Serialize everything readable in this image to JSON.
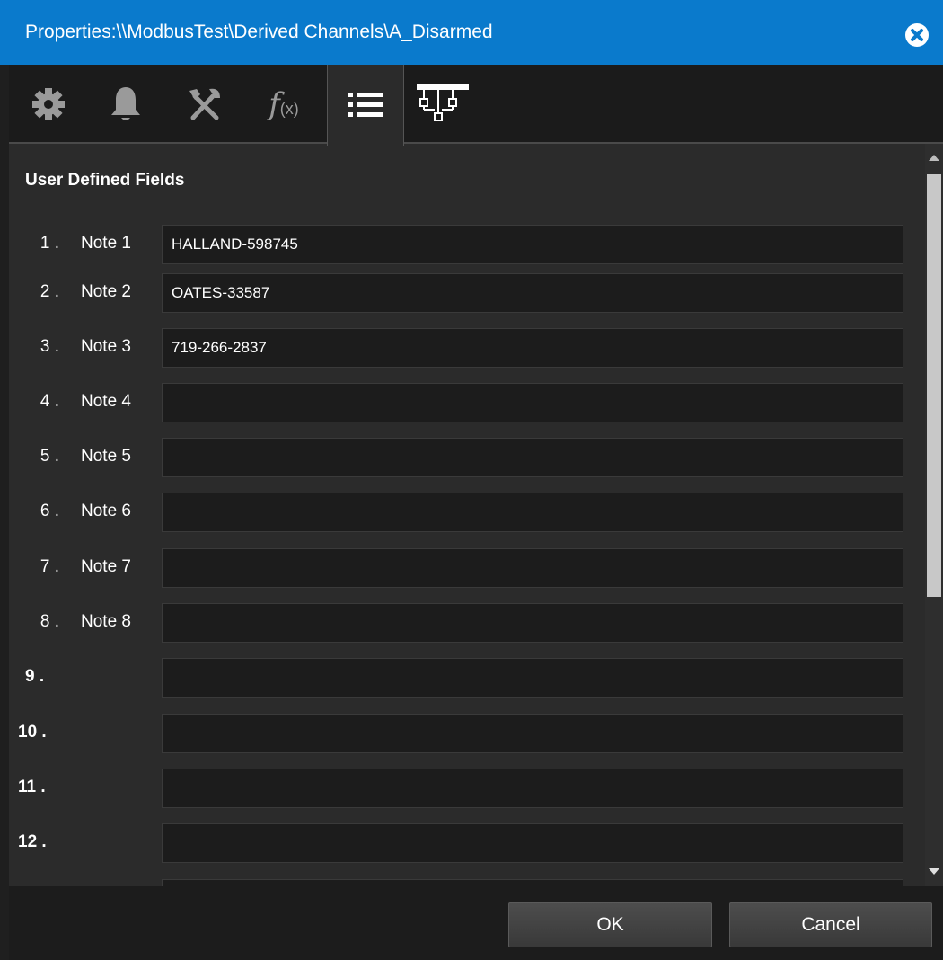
{
  "window": {
    "title": "Properties:\\\\ModbusTest\\Derived Channels\\A_Disarmed"
  },
  "toolbar": {
    "tools": [
      {
        "icon": "gear-icon"
      },
      {
        "icon": "bell-icon"
      },
      {
        "icon": "tools-icon"
      },
      {
        "icon": "function-icon",
        "label_f": "f",
        "label_x": "(x)"
      },
      {
        "icon": "list-icon",
        "active": true
      },
      {
        "icon": "network-icon"
      }
    ]
  },
  "section": {
    "title": "User Defined Fields"
  },
  "fields": [
    {
      "num": "1 .",
      "label": "Note 1",
      "value": "HALLAND-598745"
    },
    {
      "num": "2 .",
      "label": "Note 2",
      "value": "OATES-33587"
    },
    {
      "num": "3 .",
      "label": "Note 3",
      "value": "719-266-2837"
    },
    {
      "num": "4 .",
      "label": "Note 4",
      "value": ""
    },
    {
      "num": "5 .",
      "label": "Note 5",
      "value": ""
    },
    {
      "num": "6 .",
      "label": "Note 6",
      "value": ""
    },
    {
      "num": "7 .",
      "label": "Note 7",
      "value": ""
    },
    {
      "num": "8 .",
      "label": "Note 8",
      "value": ""
    },
    {
      "num": "9 .",
      "label": "",
      "value": ""
    },
    {
      "num": "10 .",
      "label": "",
      "value": ""
    },
    {
      "num": "11 .",
      "label": "",
      "value": ""
    },
    {
      "num": "12 .",
      "label": "",
      "value": ""
    }
  ],
  "footer": {
    "ok_label": "OK",
    "cancel_label": "Cancel"
  },
  "colors": {
    "titlebar": "#0a7acc",
    "background": "#2b2b2b",
    "input_bg": "#1c1c1c"
  }
}
